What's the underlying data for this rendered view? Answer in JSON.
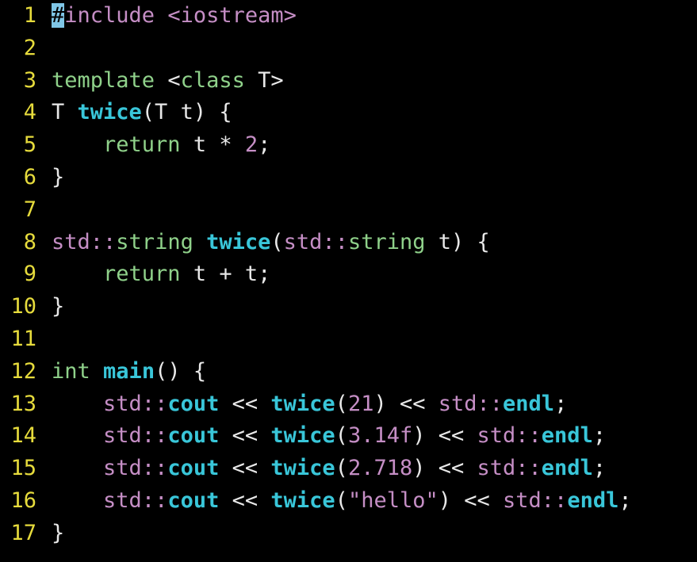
{
  "colors": {
    "background": "#000000",
    "line_number": "#e6db3c",
    "keyword_green": "#8fd18a",
    "type_purple": "#c58ec5",
    "function_cyan": "#39c6d9",
    "text": "#e8e8e8",
    "cursor": "#7fc6e6"
  },
  "line_numbers": [
    "1",
    "2",
    "3",
    "4",
    "5",
    "6",
    "7",
    "8",
    "9",
    "10",
    "11",
    "12",
    "13",
    "14",
    "15",
    "16",
    "17"
  ],
  "lines": [
    [
      {
        "t": "#",
        "c": "cursor"
      },
      {
        "t": "include ",
        "c": "t-purple"
      },
      {
        "t": "<iostream>",
        "c": "t-purple"
      }
    ],
    [],
    [
      {
        "t": "template ",
        "c": "t-green"
      },
      {
        "t": "<",
        "c": "t-white"
      },
      {
        "t": "class",
        "c": "t-green"
      },
      {
        "t": " T>",
        "c": "t-white"
      }
    ],
    [
      {
        "t": "T ",
        "c": "t-white"
      },
      {
        "t": "twice",
        "c": "t-cyan"
      },
      {
        "t": "(T t) {",
        "c": "t-white"
      }
    ],
    [
      {
        "t": "    ",
        "c": "t-white"
      },
      {
        "t": "return",
        "c": "t-green"
      },
      {
        "t": " t ",
        "c": "t-white"
      },
      {
        "t": "*",
        "c": "t-white"
      },
      {
        "t": " ",
        "c": "t-white"
      },
      {
        "t": "2",
        "c": "t-num"
      },
      {
        "t": ";",
        "c": "t-white"
      }
    ],
    [
      {
        "t": "}",
        "c": "t-white"
      }
    ],
    [],
    [
      {
        "t": "std",
        "c": "t-purple"
      },
      {
        "t": "::",
        "c": "t-purple"
      },
      {
        "t": "string",
        "c": "t-green"
      },
      {
        "t": " ",
        "c": "t-white"
      },
      {
        "t": "twice",
        "c": "t-cyan"
      },
      {
        "t": "(",
        "c": "t-white"
      },
      {
        "t": "std",
        "c": "t-purple"
      },
      {
        "t": "::",
        "c": "t-purple"
      },
      {
        "t": "string",
        "c": "t-green"
      },
      {
        "t": " t) {",
        "c": "t-white"
      }
    ],
    [
      {
        "t": "    ",
        "c": "t-white"
      },
      {
        "t": "return",
        "c": "t-green"
      },
      {
        "t": " t + t;",
        "c": "t-white"
      }
    ],
    [
      {
        "t": "}",
        "c": "t-white"
      }
    ],
    [],
    [
      {
        "t": "int",
        "c": "t-green"
      },
      {
        "t": " ",
        "c": "t-white"
      },
      {
        "t": "main",
        "c": "t-cyan"
      },
      {
        "t": "() {",
        "c": "t-white"
      }
    ],
    [
      {
        "t": "    ",
        "c": "t-white"
      },
      {
        "t": "std",
        "c": "t-purple"
      },
      {
        "t": "::",
        "c": "t-purple"
      },
      {
        "t": "cout",
        "c": "t-cyan"
      },
      {
        "t": " << ",
        "c": "t-white"
      },
      {
        "t": "twice",
        "c": "t-cyan"
      },
      {
        "t": "(",
        "c": "t-white"
      },
      {
        "t": "21",
        "c": "t-num"
      },
      {
        "t": ") << ",
        "c": "t-white"
      },
      {
        "t": "std",
        "c": "t-purple"
      },
      {
        "t": "::",
        "c": "t-purple"
      },
      {
        "t": "endl",
        "c": "t-cyan"
      },
      {
        "t": ";",
        "c": "t-white"
      }
    ],
    [
      {
        "t": "    ",
        "c": "t-white"
      },
      {
        "t": "std",
        "c": "t-purple"
      },
      {
        "t": "::",
        "c": "t-purple"
      },
      {
        "t": "cout",
        "c": "t-cyan"
      },
      {
        "t": " << ",
        "c": "t-white"
      },
      {
        "t": "twice",
        "c": "t-cyan"
      },
      {
        "t": "(",
        "c": "t-white"
      },
      {
        "t": "3.14f",
        "c": "t-num"
      },
      {
        "t": ") << ",
        "c": "t-white"
      },
      {
        "t": "std",
        "c": "t-purple"
      },
      {
        "t": "::",
        "c": "t-purple"
      },
      {
        "t": "endl",
        "c": "t-cyan"
      },
      {
        "t": ";",
        "c": "t-white"
      }
    ],
    [
      {
        "t": "    ",
        "c": "t-white"
      },
      {
        "t": "std",
        "c": "t-purple"
      },
      {
        "t": "::",
        "c": "t-purple"
      },
      {
        "t": "cout",
        "c": "t-cyan"
      },
      {
        "t": " << ",
        "c": "t-white"
      },
      {
        "t": "twice",
        "c": "t-cyan"
      },
      {
        "t": "(",
        "c": "t-white"
      },
      {
        "t": "2.718",
        "c": "t-num"
      },
      {
        "t": ") << ",
        "c": "t-white"
      },
      {
        "t": "std",
        "c": "t-purple"
      },
      {
        "t": "::",
        "c": "t-purple"
      },
      {
        "t": "endl",
        "c": "t-cyan"
      },
      {
        "t": ";",
        "c": "t-white"
      }
    ],
    [
      {
        "t": "    ",
        "c": "t-white"
      },
      {
        "t": "std",
        "c": "t-purple"
      },
      {
        "t": "::",
        "c": "t-purple"
      },
      {
        "t": "cout",
        "c": "t-cyan"
      },
      {
        "t": " << ",
        "c": "t-white"
      },
      {
        "t": "twice",
        "c": "t-cyan"
      },
      {
        "t": "(",
        "c": "t-white"
      },
      {
        "t": "\"hello\"",
        "c": "t-str"
      },
      {
        "t": ") << ",
        "c": "t-white"
      },
      {
        "t": "std",
        "c": "t-purple"
      },
      {
        "t": "::",
        "c": "t-purple"
      },
      {
        "t": "endl",
        "c": "t-cyan"
      },
      {
        "t": ";",
        "c": "t-white"
      }
    ],
    [
      {
        "t": "}",
        "c": "t-white"
      }
    ]
  ]
}
